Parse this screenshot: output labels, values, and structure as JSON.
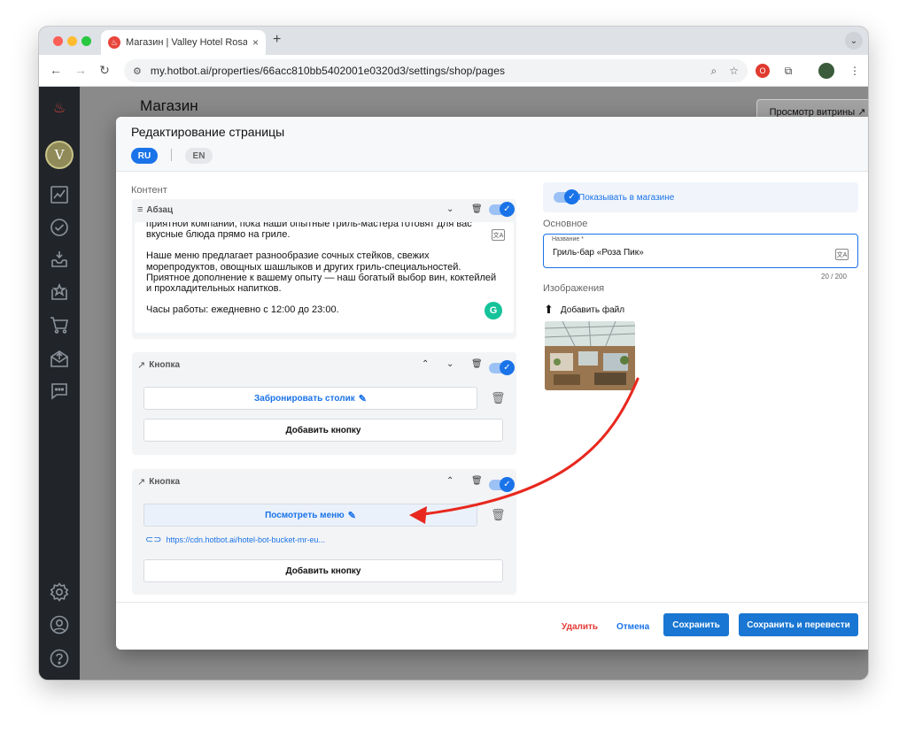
{
  "browser": {
    "tab_title": "Магазин | Valley Hotel Rosa K",
    "url": "my.hotbot.ai/properties/66acc810bb5402001e0320d3/settings/shop/pages",
    "new_tab": "+",
    "tab_close": "×"
  },
  "page": {
    "title": "Магазин",
    "storefront_button": "Просмотр витрины ↗"
  },
  "modal": {
    "title": "Редактирование страницы",
    "languages": [
      "RU",
      "EN"
    ],
    "active_language": "RU",
    "content_label": "Контент",
    "blocks": [
      {
        "type": "Абзац",
        "paragraph_lines": [
          "приятной компании, пока наши опытные гриль-мастера готовят для вас вкусные блюда прямо на гриле.",
          "Наше меню предлагает разнообразие сочных стейков, свежих морепродуктов, овощных шашлыков и других гриль-специальностей. Приятное дополнение к вашему опыту — наш богатый выбор вин, коктейлей и прохладительных напитков.",
          "Часы работы: ежедневно с 12:00 до 23:00."
        ],
        "enabled": true
      },
      {
        "type": "Кнопка",
        "button_label": "Забронировать столик",
        "add_button": "Добавить кнопку",
        "enabled": true
      },
      {
        "type": "Кнопка",
        "button_label": "Посмотреть меню",
        "link": "https://cdn.hotbot.ai/hotel-bot-bucket-mr-eu...",
        "add_button": "Добавить кнопку",
        "enabled": true
      }
    ],
    "right": {
      "show_in_shop": "Показывать в магазине",
      "show_in_shop_enabled": true,
      "basic_label": "Основное",
      "name_legend": "Название *",
      "name_value": "Гриль-бар «Роза Пик»",
      "counter": "20 / 200",
      "images_label": "Изображения",
      "add_file": "Добавить файл"
    },
    "footer": {
      "delete": "Удалить",
      "cancel": "Отмена",
      "save": "Сохранить",
      "save_translate": "Сохранить и перевести"
    }
  },
  "colors": {
    "accent": "#1a73e8",
    "primary_button": "#1976d2",
    "danger": "#e53935",
    "sidebar": "#212529",
    "annotation_arrow": "#e8281e"
  }
}
